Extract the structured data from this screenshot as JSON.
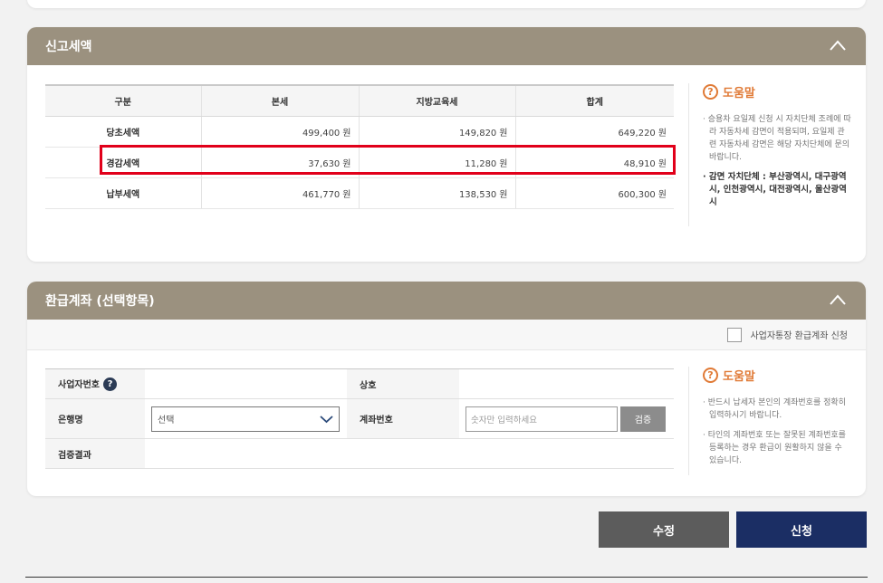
{
  "report": {
    "title": "신고세액",
    "columns": [
      "구분",
      "본세",
      "지방교육세",
      "합계"
    ],
    "unit": "원",
    "rows": [
      {
        "label": "당초세액",
        "base": "499,400",
        "edu": "149,820",
        "total": "649,220"
      },
      {
        "label": "경감세액",
        "base": "37,630",
        "edu": "11,280",
        "total": "48,910"
      },
      {
        "label": "납부세액",
        "base": "461,770",
        "edu": "138,530",
        "total": "600,300"
      }
    ],
    "help": {
      "title": "도움말",
      "note1": "· 승용차 요일제 신청 시 자치단체 조례에 따라 자동차세 감면이 적용되며, 요일제 관련 자동차세 감면은 해당 자치단체에 문의바랍니다.",
      "note2": "· 감면 자치단체 : 부산광역시, 대구광역시, 인천광역시, 대전광역시, 울산광역시"
    }
  },
  "refund": {
    "title": "환급계좌 (선택항목)",
    "business_account_label": "사업자통장 환급계좌 신청",
    "business_no_label": "사업자번호",
    "business_no_help": "?",
    "company_label": "상호",
    "bank_label": "은행명",
    "bank_selected": "선택",
    "account_label": "계좌번호",
    "account_placeholder": "숫자만 입력하세요",
    "verify_label": "검증",
    "result_label": "검증결과",
    "help": {
      "title": "도움말",
      "note1": "· 반드시 납세자 본인의 계좌번호를 정확히 입력하시기 바랍니다.",
      "note2": "· 타인의 계좌번호 또는 잘못된 계좌번호를 등록하는 경우 환급이 원활하지 않을 수 있습니다."
    }
  },
  "actions": {
    "edit_label": "수정",
    "apply_label": "신청"
  },
  "colors": {
    "header": "#9b917f",
    "highlight": "#e1001a",
    "help_accent": "#e07a36",
    "edit_button": "#5c5c5c",
    "apply_button": "#1b2e64"
  }
}
